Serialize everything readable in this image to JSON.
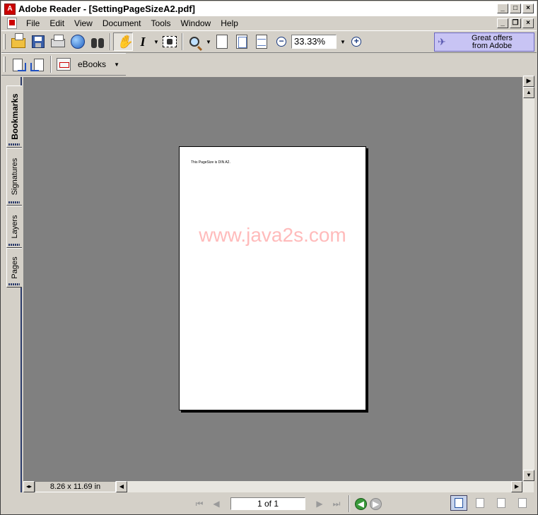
{
  "window": {
    "title": "Adobe Reader - [SettingPageSizeA2.pdf]",
    "app_icon": "adobe-reader-icon"
  },
  "menu": {
    "items": [
      "File",
      "Edit",
      "View",
      "Document",
      "Tools",
      "Window",
      "Help"
    ]
  },
  "toolbar": {
    "zoom_value": "33.33%",
    "offers_line1": "Great offers",
    "offers_line2": "from Adobe",
    "ebooks_label": "eBooks"
  },
  "side_tabs": [
    "Bookmarks",
    "Signatures",
    "Layers",
    "Pages"
  ],
  "document": {
    "page_text": "This PageSize is DIN A2.",
    "watermark": "www.java2s.com"
  },
  "statusbar": {
    "page_size": "8.26 x 11.69 in",
    "page_indicator": "1 of 1"
  }
}
